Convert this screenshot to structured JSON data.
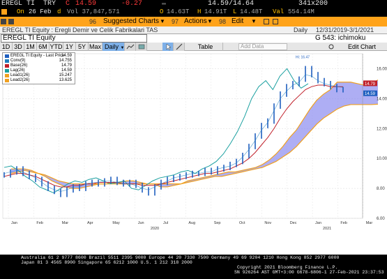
{
  "quote": {
    "ticker": "EREGL TI",
    "currency": "TRY",
    "flag": "C",
    "last": "14.59",
    "change": "-0.27",
    "bid_ask": "14.59/14.64",
    "size": "341x200",
    "date_prefix": "On",
    "date": "26 Feb",
    "vol_label": "d",
    "vol": "Vol 37,847,571",
    "open_label": "O",
    "open": "14.63T",
    "high_label": "H",
    "high": "14.91T",
    "low_label": "L",
    "low": "14.48T",
    "val_label": "Val",
    "val": "554.14M"
  },
  "toolbar": {
    "menu_num": "96",
    "suggested": "Suggested Charts",
    "actions_num": "97",
    "actions": "Actions",
    "edit_num": "98",
    "edit": "Edit"
  },
  "title": {
    "security": "EREGL TI Equity : Eregli Demir ve Celik Fabrikalari TAS",
    "freq": "Daily",
    "range": "12/31/2019-3/1/2021"
  },
  "security_bar": {
    "name": "EREGL TI Equity",
    "page": "G 543: ichimoku"
  },
  "periods": [
    "1D",
    "3D",
    "1M",
    "6M",
    "YTD",
    "1Y",
    "5Y",
    "Max"
  ],
  "freq_select": "Daily",
  "table_label": "Table",
  "add_data": "Add Data",
  "edit_chart": "Edit Chart",
  "legend": [
    {
      "label": "EREGL TI Equity - Last Price",
      "value": "14.59",
      "color": "#1f5fbf"
    },
    {
      "label": "Conv(9)",
      "value": "14.755",
      "color": "#1f7fbf"
    },
    {
      "label": "Base(26)",
      "value": "14.79",
      "color": "#c0202a"
    },
    {
      "label": "Lag(26)",
      "value": "14.59",
      "color": "#1aa0a0"
    },
    {
      "label": "Lead1(26)",
      "value": "15.247",
      "color": "#f0a020"
    },
    {
      "label": "Lead2(26)",
      "value": "13.625",
      "color": "#f0a020"
    }
  ],
  "hi_label": "Hi: 16.47",
  "last_tags": [
    "14.79",
    "14.59"
  ],
  "y_ticks": [
    "16.00",
    "14.00",
    "12.00",
    "10.00",
    "8.00",
    "6.00"
  ],
  "x_months": [
    "Jan",
    "Feb",
    "Mar",
    "Apr",
    "May",
    "Jun",
    "Jul",
    "Aug",
    "Sep",
    "Oct",
    "Nov",
    "Dec",
    "Jan",
    "Feb",
    "Mar"
  ],
  "x_years": [
    "2020",
    "2021"
  ],
  "chart_data": {
    "type": "line",
    "series": [
      {
        "name": "EREGL TI Equity - Last Price",
        "values": [
          8.9,
          9.1,
          9.3,
          9.0,
          8.8,
          8.6,
          8.3,
          8.0,
          7.8,
          7.6,
          7.9,
          8.1,
          8.0,
          8.3,
          8.4,
          8.3,
          8.5,
          8.6,
          8.4,
          8.3,
          8.4,
          8.2,
          7.9,
          7.7,
          8.1,
          8.4,
          8.6,
          8.7,
          8.8,
          8.9,
          9.0,
          9.0,
          9.2,
          9.1,
          9.3,
          9.4,
          9.6,
          9.8,
          10.2,
          10.8,
          11.5,
          12.2,
          12.5,
          13.5,
          14.3,
          14.8,
          15.0,
          15.3,
          16.0,
          15.6,
          15.2,
          15.0,
          14.8,
          14.6,
          14.59
        ]
      },
      {
        "name": "Conv(9)",
        "values": [
          9.0,
          9.1,
          9.2,
          9.1,
          8.9,
          8.7,
          8.4,
          8.1,
          7.9,
          7.8,
          7.9,
          8.1,
          8.1,
          8.3,
          8.4,
          8.4,
          8.5,
          8.5,
          8.4,
          8.3,
          8.3,
          8.2,
          8.0,
          7.9,
          8.1,
          8.3,
          8.5,
          8.7,
          8.8,
          8.9,
          9.0,
          9.0,
          9.1,
          9.1,
          9.3,
          9.4,
          9.5,
          9.7,
          10.1,
          10.6,
          11.2,
          11.9,
          12.4,
          13.2,
          14.0,
          14.5,
          14.9,
          15.1,
          15.6,
          15.5,
          15.2,
          15.0,
          14.9,
          14.8,
          14.755
        ]
      },
      {
        "name": "Base(26)",
        "values": [
          8.8,
          8.9,
          9.0,
          9.0,
          8.9,
          8.8,
          8.6,
          8.4,
          8.2,
          8.1,
          8.1,
          8.2,
          8.2,
          8.3,
          8.3,
          8.4,
          8.4,
          8.4,
          8.4,
          8.3,
          8.3,
          8.3,
          8.2,
          8.2,
          8.2,
          8.3,
          8.4,
          8.5,
          8.6,
          8.7,
          8.8,
          8.9,
          9.0,
          9.0,
          9.1,
          9.2,
          9.3,
          9.5,
          9.7,
          10.0,
          10.4,
          10.9,
          11.4,
          12.0,
          12.7,
          13.3,
          13.8,
          14.2,
          14.6,
          14.8,
          14.9,
          14.9,
          14.8,
          14.8,
          14.79
        ]
      },
      {
        "name": "Lag(26)",
        "values": [
          9.4,
          9.5,
          9.2,
          8.8,
          8.5,
          8.1,
          7.9,
          7.7,
          8.0,
          8.3,
          8.5,
          8.4,
          8.6,
          8.7,
          8.5,
          8.3,
          8.4,
          8.5,
          8.0,
          7.9,
          8.2,
          8.5,
          8.7,
          8.8,
          8.9,
          9.1,
          9.2,
          9.0,
          9.3,
          9.5,
          9.8,
          10.3,
          11.0,
          11.8,
          12.8,
          14.0,
          14.8,
          15.2,
          14.6,
          15.5,
          16.0,
          15.2,
          14.7,
          15.0
        ]
      },
      {
        "name": "Lead1(26)",
        "values": [
          9.0,
          9.1,
          9.2,
          9.1,
          9.0,
          8.8,
          8.5,
          8.3,
          8.1,
          8.0,
          8.0,
          8.1,
          8.2,
          8.3,
          8.3,
          8.4,
          8.4,
          8.5,
          8.5,
          8.4,
          8.3,
          8.3,
          8.1,
          8.1,
          8.2,
          8.3,
          8.5,
          8.6,
          8.7,
          8.8,
          8.9,
          9.0,
          9.1,
          9.1,
          9.2,
          9.3,
          9.4,
          9.6,
          9.9,
          10.3,
          10.8,
          11.4,
          11.9,
          12.6,
          13.3,
          13.9,
          14.3,
          14.6,
          15.1,
          15.1,
          15.1,
          15.0,
          14.9,
          15.0,
          15.247
        ]
      },
      {
        "name": "Lead2(26)",
        "values": [
          9.3,
          9.3,
          9.3,
          9.2,
          9.0,
          8.9,
          8.7,
          8.5,
          8.4,
          8.3,
          8.3,
          8.3,
          8.3,
          8.3,
          8.3,
          8.3,
          8.3,
          8.3,
          8.3,
          8.3,
          8.3,
          8.3,
          8.3,
          8.3,
          8.3,
          8.3,
          8.4,
          8.5,
          8.6,
          8.7,
          8.8,
          8.8,
          8.9,
          9.0,
          9.1,
          9.2,
          9.3,
          9.4,
          9.6,
          9.8,
          10.1,
          10.4,
          10.8,
          11.3,
          11.8,
          12.3,
          12.7,
          13.0,
          13.3,
          13.5,
          13.6,
          13.6,
          13.6,
          13.6,
          13.625
        ]
      }
    ],
    "ylim": [
      6.0,
      17.0
    ],
    "y_ticks": [
      6,
      8,
      10,
      12,
      14,
      16
    ],
    "legend_position": "top-left"
  },
  "footer": {
    "line1": "Australia 61 2 9777 8600 Brazil 5511 2395 9000 Europe 44 20 7330 7500 Germany 49 69 9204 1210 Hong Kong 852 2977 6000",
    "line2": "Japan 81 3 4565 8900        Singapore 65 6212 1000     U.S. 1 212 318 2000",
    "line3": "Copyright 2021 Bloomberg Finance L.P.",
    "line4": "SN 926264 AST  GMT+3:00 G678-6806-1 27-Feb-2021 23:37:53"
  }
}
